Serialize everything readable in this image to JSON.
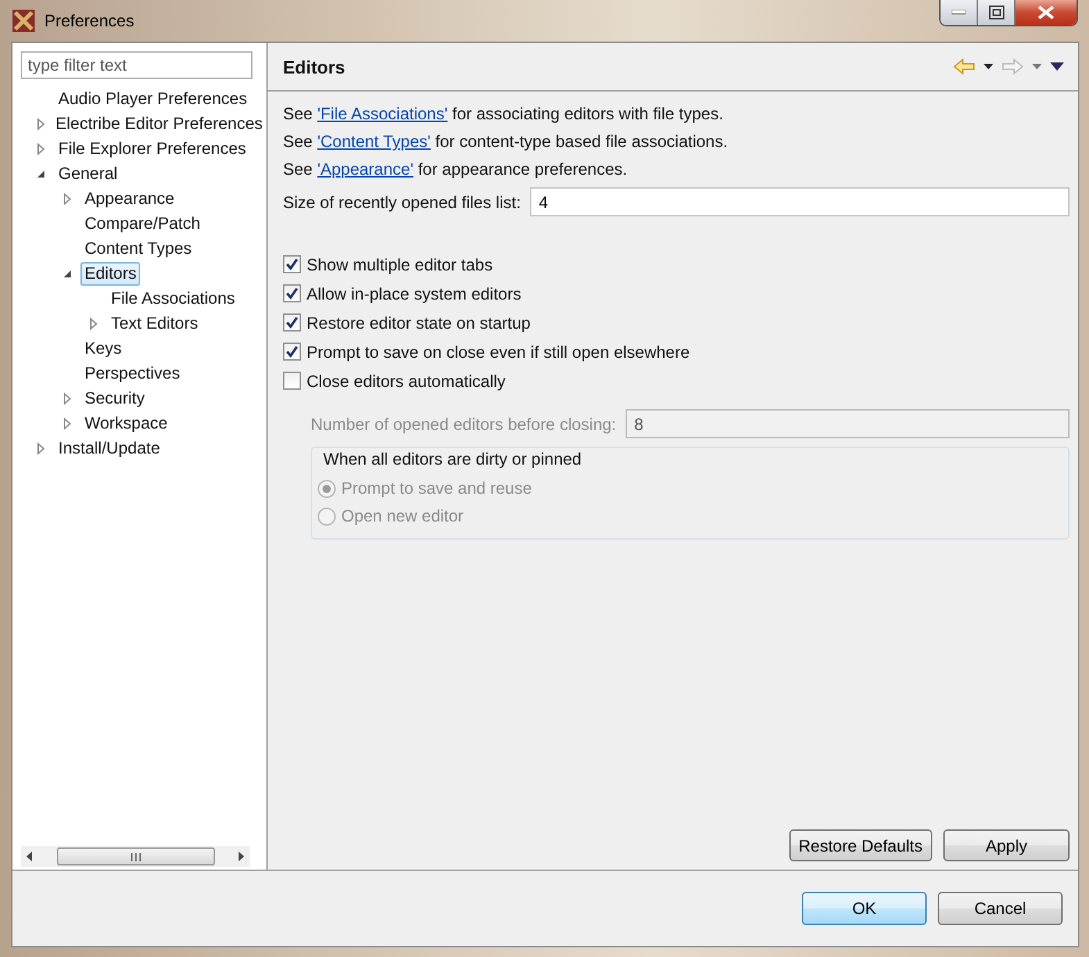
{
  "window": {
    "title": "Preferences"
  },
  "filter": {
    "placeholder": "type filter text"
  },
  "tree": [
    {
      "label": "Audio Player Preferences",
      "kind": "leaf",
      "selected": false
    },
    {
      "label": "Electribe Editor Preferences",
      "kind": "branch",
      "expanded": false,
      "selected": false
    },
    {
      "label": "File Explorer Preferences",
      "kind": "branch",
      "expanded": false,
      "selected": false
    },
    {
      "label": "General",
      "kind": "branch",
      "expanded": true,
      "selected": false,
      "children": [
        {
          "label": "Appearance",
          "kind": "branch",
          "expanded": false,
          "selected": false
        },
        {
          "label": "Compare/Patch",
          "kind": "leaf",
          "selected": false
        },
        {
          "label": "Content Types",
          "kind": "leaf",
          "selected": false
        },
        {
          "label": "Editors",
          "kind": "branch",
          "expanded": true,
          "selected": true,
          "children": [
            {
              "label": "File Associations",
              "kind": "leaf",
              "selected": false
            },
            {
              "label": "Text Editors",
              "kind": "branch",
              "expanded": false,
              "selected": false
            }
          ]
        },
        {
          "label": "Keys",
          "kind": "leaf",
          "selected": false
        },
        {
          "label": "Perspectives",
          "kind": "leaf",
          "selected": false
        },
        {
          "label": "Security",
          "kind": "branch",
          "expanded": false,
          "selected": false
        },
        {
          "label": "Workspace",
          "kind": "branch",
          "expanded": false,
          "selected": false
        }
      ]
    },
    {
      "label": "Install/Update",
      "kind": "branch",
      "expanded": false,
      "selected": false
    }
  ],
  "page": {
    "title": "Editors",
    "links": [
      {
        "before": "See ",
        "link": "'File Associations'",
        "after": " for associating editors with file types."
      },
      {
        "before": "See ",
        "link": "'Content Types'",
        "after": " for content-type based file associations."
      },
      {
        "before": "See ",
        "link": "'Appearance'",
        "after": " for appearance preferences."
      }
    ],
    "recent": {
      "label": "Size of recently opened files list:",
      "value": "4"
    },
    "checkboxes": [
      {
        "label": "Show multiple editor tabs",
        "checked": true
      },
      {
        "label": "Allow in-place system editors",
        "checked": true
      },
      {
        "label": "Restore editor state on startup",
        "checked": true
      },
      {
        "label": "Prompt to save on close even if still open elsewhere",
        "checked": true
      },
      {
        "label": "Close editors automatically",
        "checked": false
      }
    ],
    "close_options": {
      "disabled": true,
      "count_label": "Number of opened editors before closing:",
      "count_value": "8",
      "group": {
        "title": "When all editors are dirty or pinned",
        "options": [
          {
            "label": "Prompt to save and reuse",
            "selected": true
          },
          {
            "label": "Open new editor",
            "selected": false
          }
        ]
      }
    },
    "buttons": [
      "Restore Defaults",
      "Apply"
    ]
  },
  "dialog_buttons": [
    {
      "label": "OK",
      "default": true
    },
    {
      "label": "Cancel",
      "default": false
    }
  ]
}
